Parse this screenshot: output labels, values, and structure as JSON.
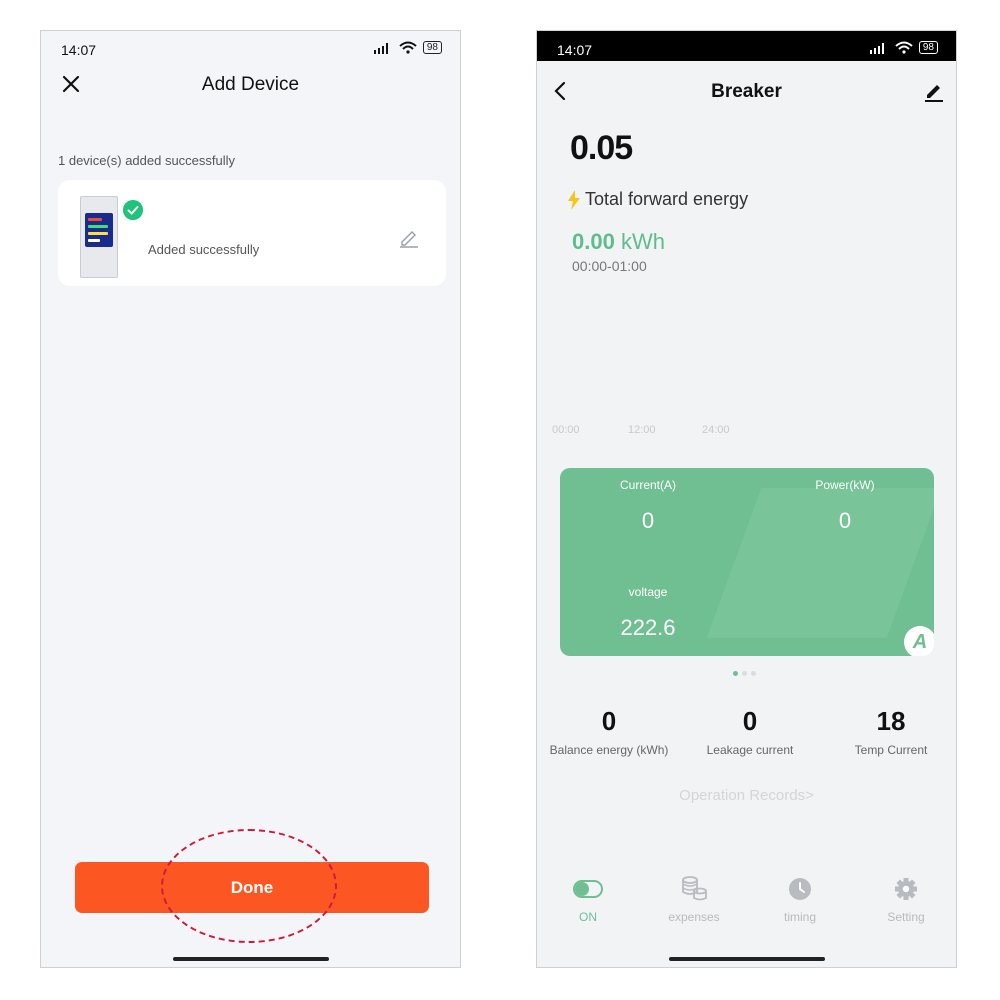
{
  "phone1": {
    "status_time": "14:07",
    "battery": "98",
    "title": "Add Device",
    "message": "1 device(s) added successfully",
    "device_status": "Added successfully",
    "done_label": "Done"
  },
  "phone2": {
    "status_time": "14:07",
    "battery": "98",
    "title": "Breaker",
    "main_value": "0.05",
    "energy_label": "Total forward energy",
    "energy_value": "0.00",
    "energy_unit": "kWh",
    "time_range": "00:00-01:00",
    "axis_ticks": [
      "00:00",
      "12:00",
      "24:00"
    ],
    "card": {
      "current_label": "Current(A)",
      "current_value": "0",
      "power_label": "Power(kW)",
      "power_value": "0",
      "voltage_label": "voltage",
      "voltage_value": "222.6",
      "badge": "A"
    },
    "stats": [
      {
        "value": "0",
        "label": "Balance energy (kWh)"
      },
      {
        "value": "0",
        "label": "Leakage current"
      },
      {
        "value": "18",
        "label": "Temp Current"
      }
    ],
    "operation_records": "Operation Records>",
    "tabs": [
      {
        "label": "ON",
        "icon": "toggle-icon",
        "active": true
      },
      {
        "label": "expenses",
        "icon": "coins-icon",
        "active": false
      },
      {
        "label": "timing",
        "icon": "clock-icon",
        "active": false
      },
      {
        "label": "Setting",
        "icon": "gear-icon",
        "active": false
      }
    ]
  },
  "colors": {
    "accent_green": "#6fbf92",
    "done_orange": "#fc5723",
    "check_green": "#20c37a",
    "annotation_red": "#d01a3b"
  }
}
